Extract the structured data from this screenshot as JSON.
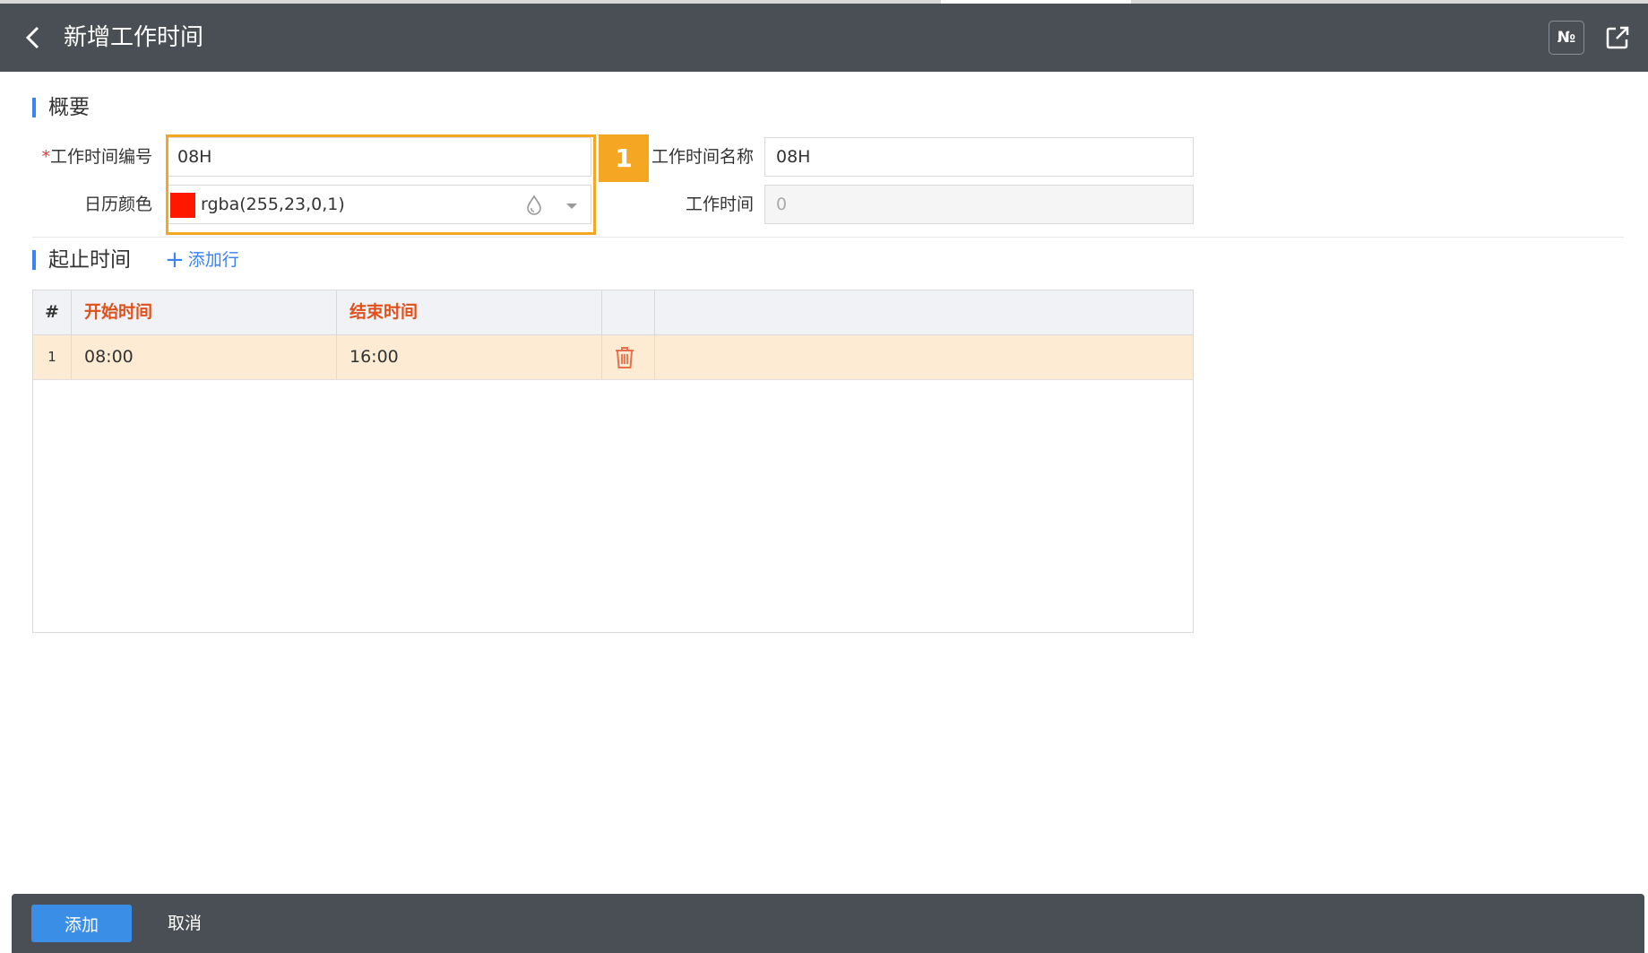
{
  "header": {
    "title": "新增工作时间",
    "no_label": "№",
    "back_icon": "chevron-left-icon",
    "share_icon": "external-link-icon"
  },
  "overview": {
    "section_title": "概要",
    "code_label": "工作时间编号",
    "required_mark": "*",
    "code_value": "08H",
    "name_label": "工作时间名称",
    "name_value": "08H",
    "color_label": "日历颜色",
    "color_value": "rgba(255,23,0,1)",
    "color_hex": "#ff1700",
    "hours_label": "工作时间",
    "hours_value": "0",
    "badge": "1"
  },
  "time_section": {
    "section_title": "起止时间",
    "add_row_label": "添加行",
    "table": {
      "headers": [
        "#",
        "开始时间",
        "结束时间"
      ],
      "rows": [
        {
          "index": "1",
          "start": "08:00",
          "end": "16:00"
        }
      ]
    }
  },
  "footer": {
    "add_label": "添加",
    "cancel_label": "取消"
  }
}
